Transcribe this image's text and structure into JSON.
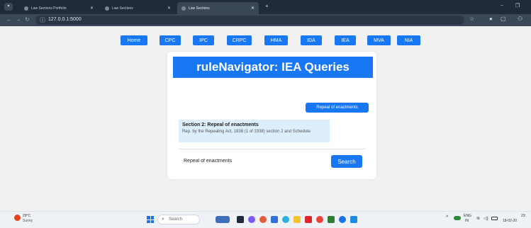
{
  "browser": {
    "tabs": [
      {
        "title": "Law Sections Portfolio",
        "active": false
      },
      {
        "title": "Law Sections",
        "active": false
      },
      {
        "title": "Law Sections",
        "active": true
      }
    ],
    "url": "127.0.0.1:5000"
  },
  "nav": {
    "buttons": [
      "Home",
      "CPC",
      "IPC",
      "CRPC",
      "HMA",
      "IDA",
      "IEA",
      "MVA",
      "NIA"
    ]
  },
  "main": {
    "title": "ruleNavigator: IEA Queries",
    "section_button": "Repeal of enactments",
    "result": {
      "title": "Section 2: Repeal of enactments",
      "description": "Rep. by the Repealing Act, 1938 (1 of 1938) section 2 and Schedule"
    },
    "query_value": "Repeal of enactments",
    "search_label": "Search"
  },
  "taskbar": {
    "weather_temp": "29°C",
    "weather_desc": "Sunny",
    "search_placeholder": "Search",
    "lang_line1": "ENG",
    "lang_line2": "IN",
    "time": "23:",
    "date": "18-02-20"
  },
  "colors": {
    "accent": "#1877f2",
    "result_bg": "#ddeefc",
    "page_bg": "#f1f1f1"
  }
}
